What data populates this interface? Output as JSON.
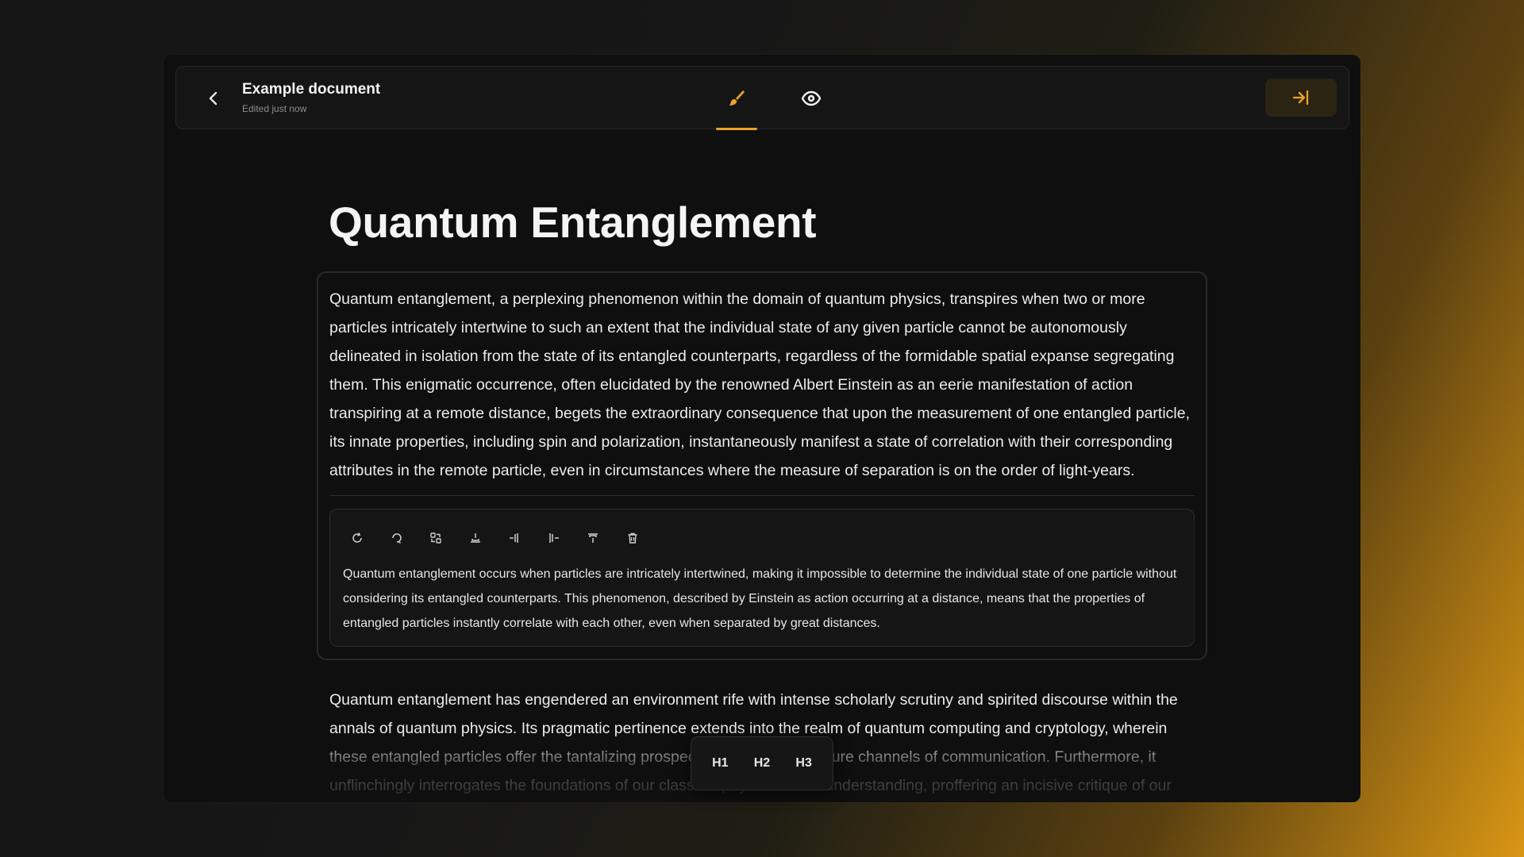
{
  "header": {
    "title": "Example document",
    "subtitle": "Edited just now",
    "back_icon": "chevron-left-icon",
    "modes": [
      {
        "name": "edit",
        "icon": "brush-icon",
        "active": true
      },
      {
        "name": "preview",
        "icon": "eye-icon",
        "active": false
      }
    ],
    "exit_icon": "login-arrow-icon"
  },
  "colors": {
    "accent": "#e8a426",
    "window_bg": "#0f0f0f",
    "text": "#ececec"
  },
  "document": {
    "heading": "Quantum Entanglement",
    "paragraph1": "Quantum entanglement, a perplexing phenomenon within the domain of quantum physics, transpires when two or more particles intricately intertwine to such an extent that the individual state of any given particle cannot be autonomously delineated in isolation from the state of its entangled counterparts, regardless of the formidable spatial expanse segregating them. This enigmatic occurrence, often elucidated by the renowned Albert Einstein as an eerie manifestation of action transpiring at a remote distance, begets the extraordinary consequence that upon the measurement of one entangled particle, its innate properties, including spin and polarization, instantaneously manifest a state of correlation with their corresponding attributes in the remote particle, even in circumstances where the measure of separation is on the order of light-years.",
    "ai_suggestion": "Quantum entanglement occurs when particles are intricately intertwined, making it impossible to determine the individual state of one particle without considering its entangled counterparts. This phenomenon, described by Einstein as action occurring at a distance, means that the properties of entangled particles instantly correlate with each other, even when separated by great distances.",
    "ai_tools": [
      "refresh-icon",
      "rephrase-icon",
      "replace-icon",
      "insert-below-icon",
      "insert-left-icon",
      "insert-right-icon",
      "insert-above-icon",
      "trash-icon"
    ],
    "paragraph2": "Quantum entanglement has engendered an environment rife with intense scholarly scrutiny and spirited discourse within the annals of quantum physics. Its pragmatic pertinence extends into the realm of quantum computing and cryptology, wherein these entangled particles offer the tantalizing prospect of establishing secure channels of communication. Furthermore, it unflinchingly interrogates the foundations of our classical physics-based understanding, proffering an incisive critique of our conventional"
  },
  "heading_bar": {
    "h1": "H1",
    "h2": "H2",
    "h3": "H3"
  }
}
